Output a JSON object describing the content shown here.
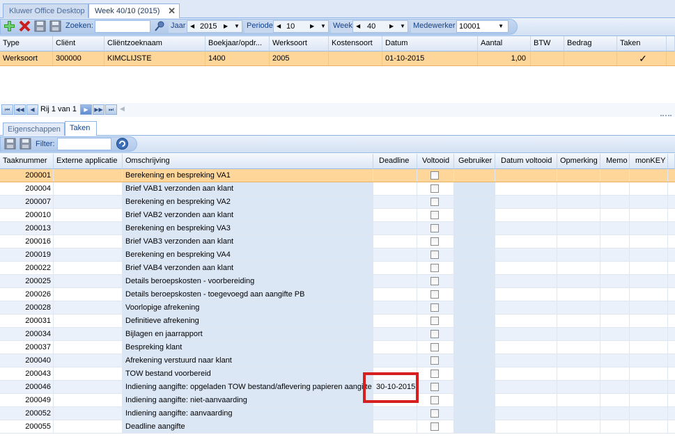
{
  "tabs": [
    {
      "label": "Kluwer Office Desktop",
      "active": false
    },
    {
      "label": "Week 40/10 (2015)",
      "active": true
    }
  ],
  "toolbar": {
    "search_label": "Zoeken:",
    "search_value": "",
    "jaar_label": "Jaar",
    "jaar_value": "2015",
    "periode_label": "Periode",
    "periode_value": "10",
    "week_label": "Week",
    "week_value": "40",
    "medewerker_label": "Medewerker",
    "medewerker_value": "10001"
  },
  "top_grid": {
    "columns": [
      "Type",
      "Cliënt",
      "Cliëntzoeknaam",
      "Boekjaar/opdr...",
      "Werksoort",
      "Kostensoort",
      "Datum",
      "Aantal",
      "BTW",
      "Bedrag",
      "Taken"
    ],
    "row": {
      "type": "Werksoort",
      "client": "300000",
      "clientzoeknaam": "KIMCLIJSTE",
      "boekjaar": "1400",
      "werksoort": "2005",
      "kostensoort": "",
      "datum": "01-10-2015",
      "aantal": "1,00",
      "btw": "",
      "bedrag": "",
      "taken": "✓"
    }
  },
  "navigator": {
    "row_text": "Rij 1 van 1"
  },
  "lower_tabs": [
    {
      "label": "Eigenschappen",
      "active": false
    },
    {
      "label": "Taken",
      "active": true
    }
  ],
  "filter": {
    "label": "Filter:",
    "value": ""
  },
  "task_grid": {
    "columns": [
      "Taaknummer",
      "Externe applicatie",
      "Omschrijving",
      "Deadline",
      "Voltooid",
      "Gebruiker",
      "Datum voltooid",
      "Opmerking",
      "Memo",
      "monKEY"
    ],
    "rows": [
      {
        "nr": "200001",
        "omschrijving": "Berekening en bespreking VA1",
        "deadline": ""
      },
      {
        "nr": "200004",
        "omschrijving": "Brief VAB1 verzonden aan klant",
        "deadline": ""
      },
      {
        "nr": "200007",
        "omschrijving": "Berekening en bespreking VA2",
        "deadline": ""
      },
      {
        "nr": "200010",
        "omschrijving": "Brief VAB2 verzonden aan klant",
        "deadline": ""
      },
      {
        "nr": "200013",
        "omschrijving": "Berekening en bespreking VA3",
        "deadline": ""
      },
      {
        "nr": "200016",
        "omschrijving": "Brief VAB3 verzonden aan klant",
        "deadline": ""
      },
      {
        "nr": "200019",
        "omschrijving": "Berekening en bespreking VA4",
        "deadline": ""
      },
      {
        "nr": "200022",
        "omschrijving": "Brief VAB4 verzonden aan klant",
        "deadline": ""
      },
      {
        "nr": "200025",
        "omschrijving": "Details beroepskosten -  voorbereiding",
        "deadline": ""
      },
      {
        "nr": "200026",
        "omschrijving": "Details beroepskosten -  toegevoegd aan aangifte PB",
        "deadline": ""
      },
      {
        "nr": "200028",
        "omschrijving": "Voorlopige afrekening",
        "deadline": ""
      },
      {
        "nr": "200031",
        "omschrijving": "Definitieve afrekening",
        "deadline": ""
      },
      {
        "nr": "200034",
        "omschrijving": "Bijlagen en jaarrapport",
        "deadline": ""
      },
      {
        "nr": "200037",
        "omschrijving": "Bespreking klant",
        "deadline": ""
      },
      {
        "nr": "200040",
        "omschrijving": "Afrekening verstuurd naar klant",
        "deadline": ""
      },
      {
        "nr": "200043",
        "omschrijving": "TOW bestand voorbereid",
        "deadline": ""
      },
      {
        "nr": "200046",
        "omschrijving": "Indiening aangifte: opgeladen TOW bestand/aflevering papieren aangifte",
        "deadline": "30-10-2015"
      },
      {
        "nr": "200049",
        "omschrijving": "Indiening aangifte: niet-aanvaarding",
        "deadline": ""
      },
      {
        "nr": "200052",
        "omschrijving": "Indiening aangifte: aanvaarding",
        "deadline": ""
      },
      {
        "nr": "200055",
        "omschrijving": "Deadline aangifte",
        "deadline": ""
      }
    ]
  },
  "colors": {
    "selected_row": "#ffd69a",
    "highlight_box": "#d81f1f",
    "header_blue": "#dfe8f6"
  }
}
